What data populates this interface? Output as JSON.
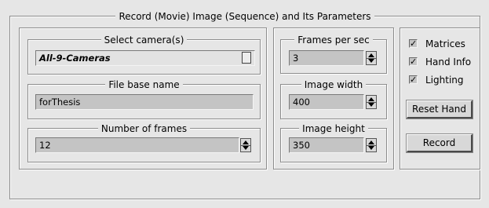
{
  "main_title": "Record (Movie) Image (Sequence) and Its Parameters",
  "camera": {
    "legend": "Select camera(s)",
    "value": "All-9-Cameras"
  },
  "filename": {
    "legend": "File base name",
    "value": "forThesis"
  },
  "num_frames": {
    "legend": "Number of frames",
    "value": "12"
  },
  "fps": {
    "legend": "Frames per sec",
    "value": "3"
  },
  "width": {
    "legend": "Image width",
    "value": "400"
  },
  "height": {
    "legend": "Image height",
    "value": "350"
  },
  "options": [
    {
      "label": "Matrices",
      "checked": true
    },
    {
      "label": "Hand Info",
      "checked": true
    },
    {
      "label": "Lighting",
      "checked": true
    }
  ],
  "buttons": {
    "reset_hand": "Reset Hand",
    "record": "Record"
  }
}
